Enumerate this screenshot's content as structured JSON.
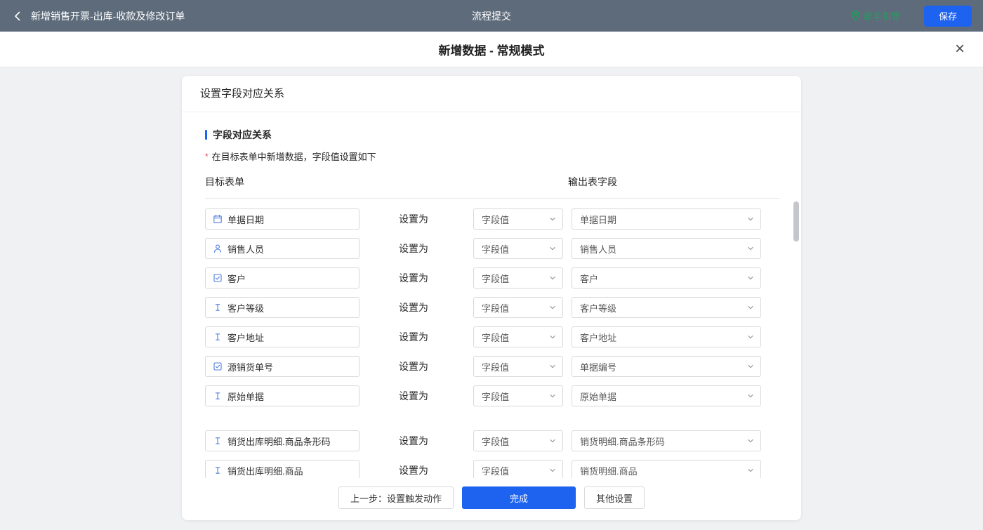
{
  "topbar": {
    "title": "新增销售开票-出库-收款及修改订单",
    "center_title": "流程提交",
    "guide_label": "新手引导",
    "save_label": "保存"
  },
  "modal": {
    "title": "新增数据 - 常规模式",
    "close_glyph": "×"
  },
  "panel": {
    "header": "设置字段对应关系",
    "section_title": "字段对应关系",
    "required_mark": "*",
    "required_note": "在目标表单中新增数据，字段值设置如下",
    "col_left": "目标表单",
    "col_right": "输出表字段",
    "set_as_label": "设置为",
    "rows": [
      {
        "icon": "calendar",
        "field": "单据日期",
        "mode": "字段值",
        "value": "单据日期",
        "group": 1
      },
      {
        "icon": "person",
        "field": "销售人员",
        "mode": "字段值",
        "value": "销售人员",
        "group": 1
      },
      {
        "icon": "checkbox",
        "field": "客户",
        "mode": "字段值",
        "value": "客户",
        "group": 1
      },
      {
        "icon": "text",
        "field": "客户等级",
        "mode": "字段值",
        "value": "客户等级",
        "group": 1
      },
      {
        "icon": "text",
        "field": "客户地址",
        "mode": "字段值",
        "value": "客户地址",
        "group": 1
      },
      {
        "icon": "checkbox",
        "field": "源销货单号",
        "mode": "字段值",
        "value": "单据编号",
        "group": 1
      },
      {
        "icon": "text",
        "field": "原始单据",
        "mode": "字段值",
        "value": "原始单据",
        "group": 1
      },
      {
        "icon": "text",
        "field": "销货出库明细.商品条形码",
        "mode": "字段值",
        "value": "销货明细.商品条形码",
        "group": 2
      },
      {
        "icon": "text",
        "field": "销货出库明细.商品",
        "mode": "字段值",
        "value": "销货明细.商品",
        "group": 2
      }
    ],
    "footer": {
      "prev_label": "上一步：设置触发动作",
      "done_label": "完成",
      "other_label": "其他设置"
    }
  },
  "colors": {
    "topbar_bg": "#5d6b7a",
    "accent_blue": "#1d63f0",
    "guide_green": "#1fa35c",
    "required_red": "#e34d59"
  }
}
